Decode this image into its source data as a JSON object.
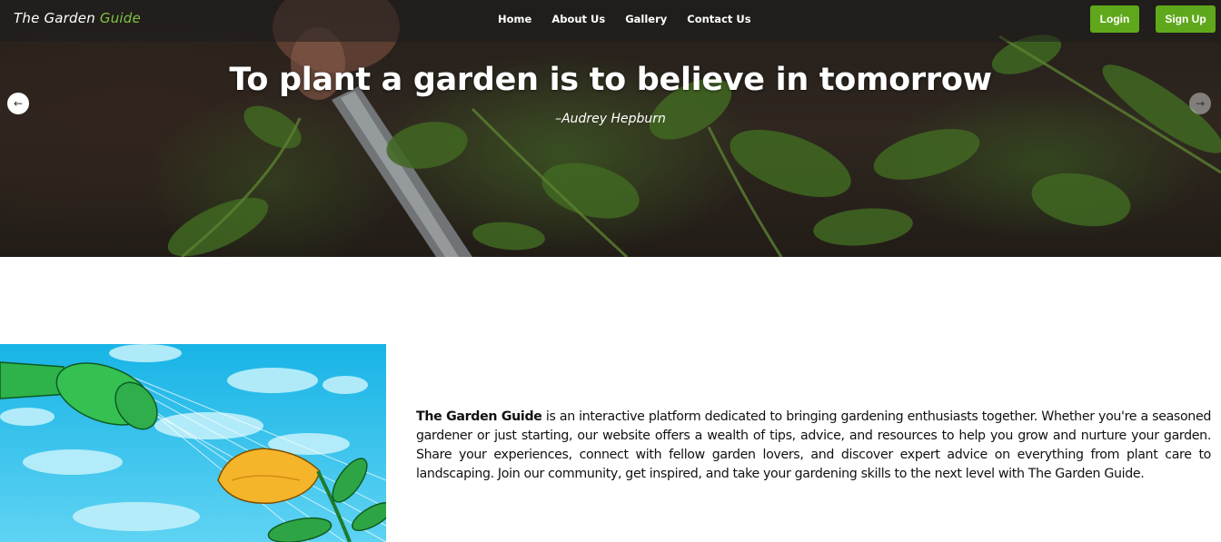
{
  "brand": {
    "name": "The Garden",
    "accent": "Guide"
  },
  "nav": {
    "links": [
      "Home",
      "About Us",
      "Gallery",
      "Contact Us"
    ]
  },
  "auth": {
    "login": "Login",
    "signup": "Sign Up"
  },
  "hero": {
    "quote": "To plant a garden is to believe in tomorrow",
    "author": "–Audrey Hepburn"
  },
  "about": {
    "highlight": "The Garden Guide",
    "text": " is an interactive platform dedicated to bringing gardening enthusiasts together. Whether you're a seasoned gardener or just starting, our website offers a wealth of tips, advice, and resources to help you grow and nurture your garden. Share your experiences, connect with fellow garden lovers, and discover expert advice on everything from plant care to landscaping. Join our community, get inspired, and take your gardening skills to the next level with The Garden Guide."
  },
  "icons": {
    "prev": "arrow-left-icon",
    "next": "arrow-right-icon"
  },
  "colors": {
    "accent": "#5fa81b",
    "brand_accent": "#7dc242"
  }
}
